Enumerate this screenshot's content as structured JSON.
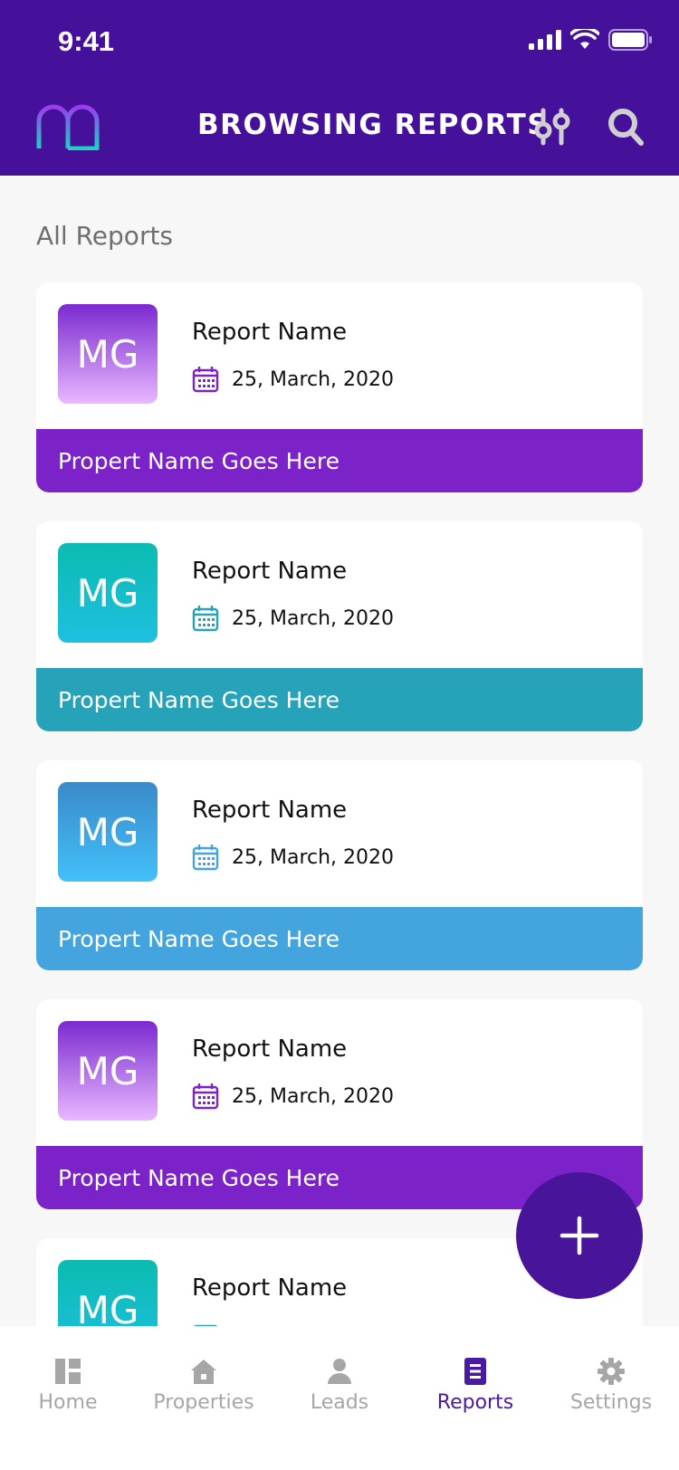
{
  "status_bar": {
    "time": "9:41"
  },
  "header": {
    "title": "BROWSING REPORTS"
  },
  "section": {
    "title": "All Reports"
  },
  "reports": [
    {
      "initials": "MG",
      "name": "Report Name",
      "date": "25, March, 2020",
      "property": "Propert Name Goes Here",
      "theme": "purple"
    },
    {
      "initials": "MG",
      "name": "Report Name",
      "date": "25, March, 2020",
      "property": "Propert Name Goes Here",
      "theme": "teal"
    },
    {
      "initials": "MG",
      "name": "Report Name",
      "date": "25, March, 2020",
      "property": "Propert Name Goes Here",
      "theme": "blue"
    },
    {
      "initials": "MG",
      "name": "Report Name",
      "date": "25, March, 2020",
      "property": "Propert Name Goes Here",
      "theme": "purple"
    },
    {
      "initials": "MG",
      "name": "Report Name",
      "date": "",
      "property": "",
      "theme": "teal"
    }
  ],
  "tabs": [
    {
      "label": "Home",
      "icon": "home-icon"
    },
    {
      "label": "Properties",
      "icon": "house-icon"
    },
    {
      "label": "Leads",
      "icon": "person-icon"
    },
    {
      "label": "Reports",
      "icon": "report-icon",
      "active": true
    },
    {
      "label": "Settings",
      "icon": "gear-icon"
    }
  ],
  "colors": {
    "header": "#45119a",
    "purple": "#7b22c8",
    "teal": "#26a3b9",
    "blue": "#43a4de",
    "active_tab": "#4a1aa0",
    "inactive_tab": "#a6a6a6"
  }
}
